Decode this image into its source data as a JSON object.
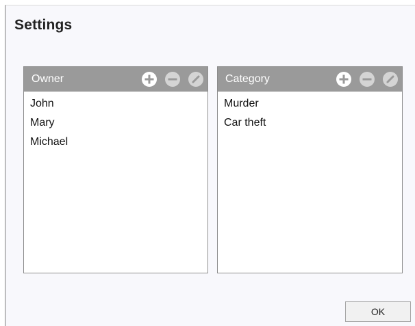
{
  "dialog": {
    "title": "Settings",
    "ok_label": "OK"
  },
  "panels": {
    "owner": {
      "title": "Owner",
      "items": [
        "John",
        "Mary",
        "Michael"
      ],
      "add_icon": "plus-circle-icon",
      "remove_icon": "minus-circle-icon",
      "edit_icon": "pencil-circle-icon"
    },
    "category": {
      "title": "Category",
      "items": [
        "Murder",
        "Car theft"
      ],
      "add_icon": "plus-circle-icon",
      "remove_icon": "minus-circle-icon",
      "edit_icon": "pencil-circle-icon"
    }
  },
  "colors": {
    "header_bg": "#9a9a9a",
    "icon_active": "#ffffff",
    "icon_disabled": "#d4d4d4"
  }
}
